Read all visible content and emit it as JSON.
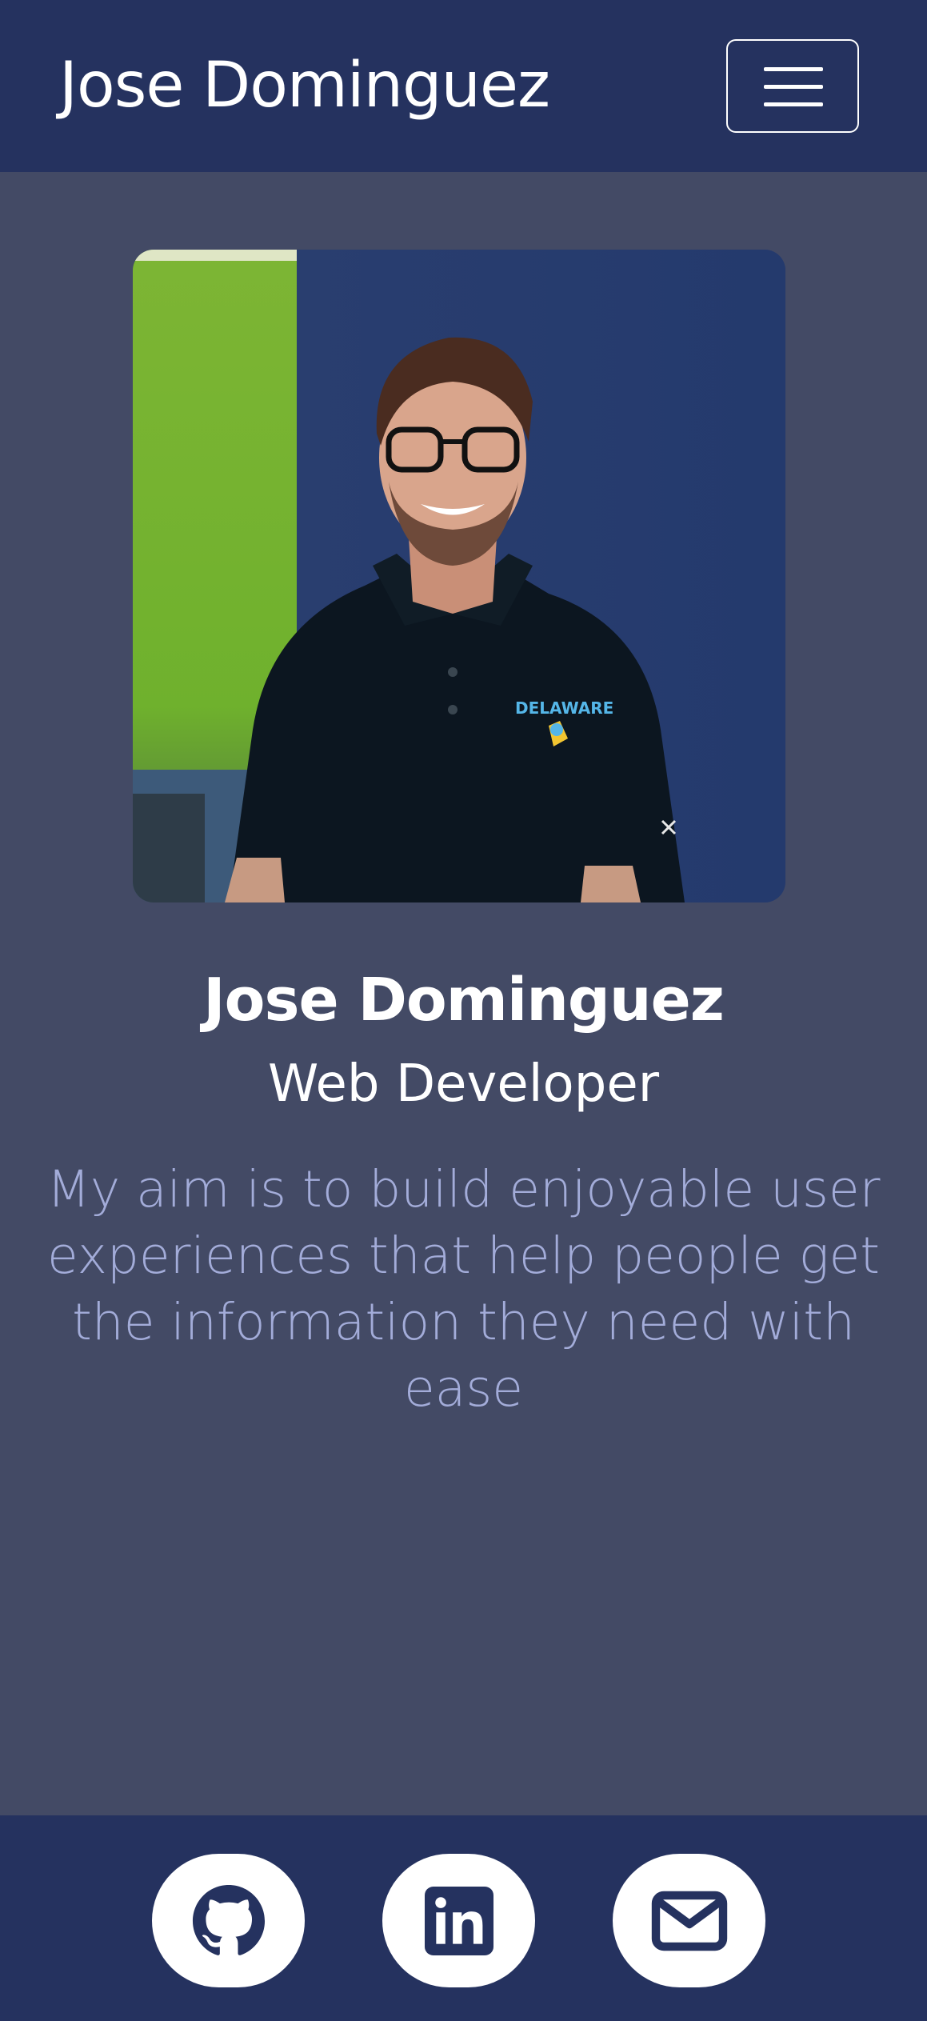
{
  "navbar": {
    "brand": "Jose Dominguez",
    "toggle_icon": "hamburger-menu-icon"
  },
  "profile": {
    "photo_icon": "profile-photo",
    "shirt_text": "DELAWARE",
    "name": "Jose Dominguez",
    "role": "Web Developer",
    "tagline": "My aim is to build enjoyable user experiences that help people get the information they need with ease"
  },
  "footer": {
    "links": [
      {
        "icon": "github-icon"
      },
      {
        "icon": "linkedin-icon"
      },
      {
        "icon": "email-icon"
      }
    ]
  },
  "colors": {
    "navbar_bg": "#25325f",
    "page_bg": "#434a65",
    "tagline": "#a3acd9",
    "icon": "#25325f"
  }
}
